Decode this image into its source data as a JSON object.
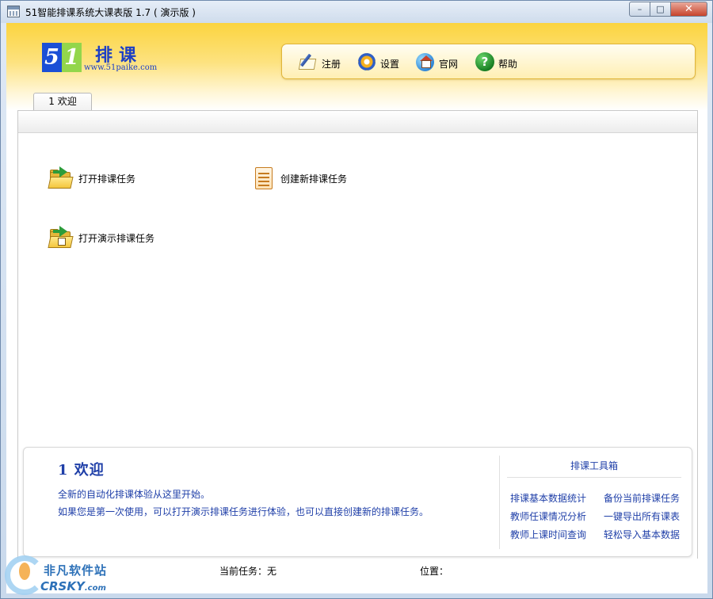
{
  "window": {
    "title": "51智能排课系统大课表版 1.7 ( 演示版 )",
    "controls": {
      "minimize": "–",
      "maximize": "□",
      "close": "✕"
    }
  },
  "logo": {
    "digit_5": "5",
    "digit_1": "1",
    "name": "排课",
    "url": "www.51paike.com"
  },
  "toolbar": {
    "items": [
      {
        "label": "注册",
        "icon": "register-icon"
      },
      {
        "label": "设置",
        "icon": "gear-icon"
      },
      {
        "label": "官网",
        "icon": "website-icon"
      },
      {
        "label": "帮助",
        "icon": "help-icon"
      }
    ]
  },
  "tabs": [
    {
      "label": "1 欢迎"
    }
  ],
  "actions": {
    "open_task": "打开排课任务",
    "new_task": "创建新排课任务",
    "open_demo": "打开演示排课任务"
  },
  "welcome": {
    "title": "1 欢迎",
    "line1": "全新的自动化排课体验从这里开始。",
    "line2": "如果您是第一次使用，可以打开演示排课任务进行体验，也可以直接创建新的排课任务。"
  },
  "toolbox": {
    "title": "排课工具箱",
    "links": [
      "排课基本数据统计",
      "备份当前排课任务",
      "教师任课情况分析",
      "一键导出所有课表",
      "教师上课时间查询",
      "轻松导入基本数据"
    ]
  },
  "status": {
    "current_task": "当前任务：无",
    "position": "位置："
  },
  "watermark": {
    "cn": "非凡软件站",
    "en": "CRSKY",
    "en_suffix": ".com"
  },
  "colors": {
    "header_yellow": "#fbd43f",
    "link_blue": "#1f3fa8",
    "logo_blue": "#1b4fd6",
    "logo_green": "#93d64b"
  }
}
